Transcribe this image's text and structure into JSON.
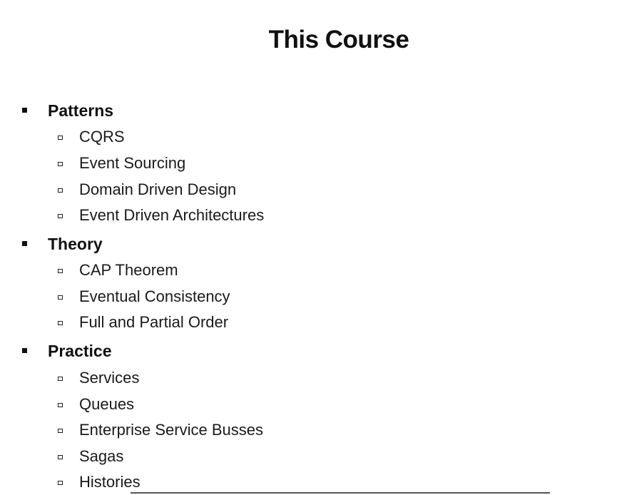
{
  "slide": {
    "title": "This Course",
    "sections": [
      {
        "label": "Patterns",
        "items": [
          "CQRS",
          "Event Sourcing",
          "Domain Driven Design",
          "Event Driven Architectures"
        ]
      },
      {
        "label": "Theory",
        "items": [
          "CAP Theorem",
          "Eventual Consistency",
          "Full and Partial Order"
        ]
      },
      {
        "label": "Practice",
        "items": [
          "Services",
          "Queues",
          "Enterprise Service Busses",
          "Sagas",
          "Histories"
        ]
      }
    ]
  }
}
